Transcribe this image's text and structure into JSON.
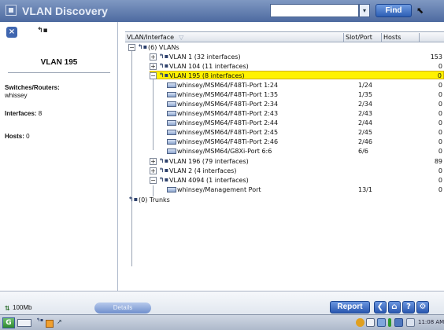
{
  "app": {
    "title": "VLAN Discovery"
  },
  "toolbar": {
    "search_value": "",
    "find_label": "Find"
  },
  "details": {
    "heading": "VLAN 195",
    "switches_label": "Switches/Routers:",
    "switches_value": "whissey",
    "interfaces_label": "Interfaces:",
    "interfaces_value": "8",
    "hosts_label": "Hosts:",
    "hosts_value": "0"
  },
  "columns": {
    "interface": "VLAN/Interface",
    "slot_port": "Slot/Port",
    "hosts": "Hosts"
  },
  "tree": {
    "root_label": "(6) VLANs",
    "vlans": [
      {
        "label": "VLAN 1 (32 interfaces)",
        "hosts": "153",
        "expander": "+"
      },
      {
        "label": "VLAN 104 (11 interfaces)",
        "hosts": "0",
        "expander": "+"
      },
      {
        "label": "VLAN 195 (8 interfaces)",
        "hosts": "0",
        "expander": "−"
      },
      {
        "label": "VLAN 196 (79 interfaces)",
        "hosts": "89",
        "expander": "+"
      },
      {
        "label": "VLAN 2 (4 interfaces)",
        "hosts": "0",
        "expander": "+"
      },
      {
        "label": "VLAN 4094 (1 interfaces)",
        "hosts": "0",
        "expander": "−"
      }
    ],
    "vlan195_ports": [
      {
        "label": "whinsey/MSM64/F48Ti-Port 1:24",
        "slot": "1/24",
        "hosts": "0"
      },
      {
        "label": "whinsey/MSM64/F48Ti-Port 1:35",
        "slot": "1/35",
        "hosts": "0"
      },
      {
        "label": "whinsey/MSM64/F48Ti-Port 2:34",
        "slot": "2/34",
        "hosts": "0"
      },
      {
        "label": "whinsey/MSM64/F48Ti-Port 2:43",
        "slot": "2/43",
        "hosts": "0"
      },
      {
        "label": "whinsey/MSM64/F48Ti-Port 2:44",
        "slot": "2/44",
        "hosts": "0"
      },
      {
        "label": "whinsey/MSM64/F48Ti-Port 2:45",
        "slot": "2/45",
        "hosts": "0"
      },
      {
        "label": "whinsey/MSM64/F48Ti-Port 2:46",
        "slot": "2/46",
        "hosts": "0"
      },
      {
        "label": "whinsey/MSM64/G8Xi-Port 6:6",
        "slot": "6/6",
        "hosts": "0"
      }
    ],
    "vlan4094_ports": [
      {
        "label": "whinsey/Management Port",
        "slot": "13/1",
        "hosts": "0"
      }
    ],
    "trunks_label": "(0) Trunks"
  },
  "status": {
    "link_speed": "100Mb",
    "details_label": "Details",
    "report_label": "Report"
  },
  "bottom_tools": [
    "back-icon",
    "home-icon",
    "help-icon",
    "tools-icon"
  ],
  "colors": {
    "accent": "#2d5fb5",
    "selection": "#fff200",
    "title_bar": "#5f7cae"
  }
}
